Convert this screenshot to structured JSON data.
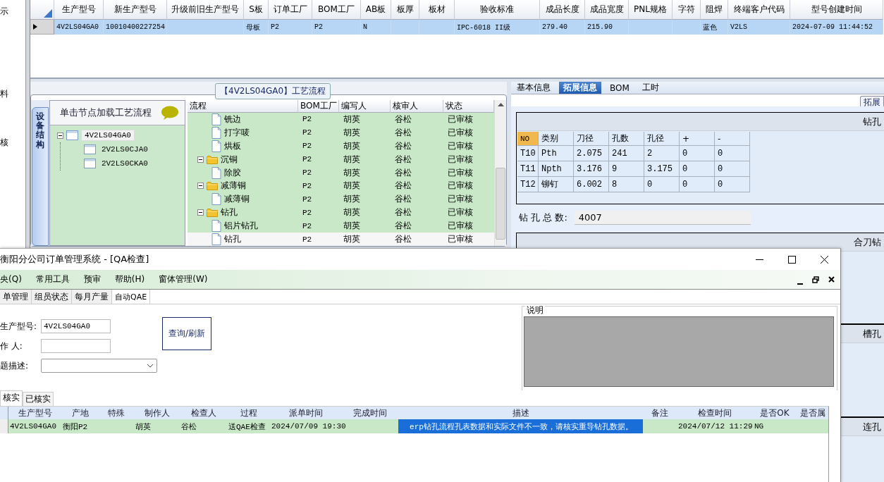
{
  "left_strip": [
    {
      "label": "示"
    },
    {
      "label": "料"
    },
    {
      "label": "核"
    }
  ],
  "model_table": {
    "columns": [
      "生产型号",
      "新生产型号",
      "升级前旧生产型号",
      "S板",
      "订单工厂",
      "BOM工厂",
      "AB板",
      "板厚",
      "板材",
      "验收标准",
      "成品长度",
      "成品宽度",
      "PNL规格",
      "字符",
      "阻焊",
      "终端客户代码",
      "型号创建时间"
    ],
    "rows": [
      {
        "selected": true,
        "cells": [
          "4V2LS04GA0",
          "10010400227254",
          null,
          "母板",
          "P2",
          "P2",
          "N",
          null,
          null,
          "IPC-6018 II级",
          "279.40",
          "215.90",
          null,
          null,
          "蓝色",
          "V2LS",
          "2024-07-09 11:44:52"
        ]
      }
    ]
  },
  "process_panel": {
    "title": "【4V2LS04GA0】工艺流程",
    "side_tab": "设备结构",
    "tree_header": "单击节点加载工艺流程",
    "tree": [
      {
        "label": "4V2LS04GA0",
        "selected": true,
        "expanded": true,
        "children": [
          {
            "label": "2V2LS0CJA0",
            "selected": false
          },
          {
            "label": "2V2LS0CKA0",
            "selected": false
          }
        ]
      }
    ],
    "flow_grid": {
      "tree_column": "流程",
      "columns": [
        "BOM工厂",
        "编写人",
        "核审人",
        "状态"
      ],
      "rows": [
        {
          "kind": "file",
          "label": "铣边",
          "cells": [
            "P2",
            "胡英",
            "谷松",
            "已审核"
          ],
          "selected": false
        },
        {
          "kind": "file",
          "label": "打字唛",
          "cells": [
            "P2",
            "胡英",
            "谷松",
            "已审核"
          ],
          "selected": false
        },
        {
          "kind": "file",
          "label": "烘板",
          "cells": [
            "P2",
            "胡英",
            "谷松",
            "已审核"
          ],
          "selected": false
        },
        {
          "kind": "folder",
          "label": "沉铜",
          "cells": [
            "P2",
            "胡英",
            "谷松",
            "已审核"
          ],
          "selected": false,
          "expanded": true,
          "children": [
            {
              "kind": "file",
              "label": "除胶",
              "cells": [
                "P2",
                "胡英",
                "谷松",
                "已审核"
              ],
              "selected": false
            }
          ]
        },
        {
          "kind": "folder",
          "label": "减薄铜",
          "cells": [
            "P2",
            "胡英",
            "谷松",
            "已审核"
          ],
          "selected": false,
          "expanded": true,
          "children": [
            {
              "kind": "file",
              "label": "减薄铜",
              "cells": [
                "P2",
                "胡英",
                "谷松",
                "已审核"
              ],
              "selected": false
            }
          ]
        },
        {
          "kind": "folder",
          "label": "钻孔",
          "cells": [
            "P2",
            "胡英",
            "谷松",
            "已审核"
          ],
          "selected": false,
          "expanded": true,
          "children": [
            {
              "kind": "file",
              "label": "铝片钻孔",
              "cells": [
                "P2",
                "胡英",
                "谷松",
                "已审核"
              ],
              "selected": false
            },
            {
              "kind": "file",
              "label": "钻孔",
              "cells": [
                "P2",
                "胡英",
                "谷松",
                "已审核"
              ],
              "selected": true
            }
          ]
        }
      ]
    }
  },
  "info_panel": {
    "tabs": [
      {
        "label": "基本信息",
        "selected": false
      },
      {
        "label": "拓展信息",
        "selected": true
      },
      {
        "label": "BOM",
        "selected": false
      },
      {
        "label": "工时",
        "selected": false
      }
    ],
    "sub_tab": "拓展",
    "drill_group": {
      "title": "钻孔",
      "columns": [
        "NO",
        "类别",
        "刀径",
        "孔数",
        "孔径",
        "+",
        "-"
      ],
      "rows": [
        [
          "T10",
          "Pth",
          "2.075",
          "241",
          "2",
          "0",
          "0"
        ],
        [
          "T11",
          "Npth",
          "3.176",
          "9",
          "3.175",
          "0",
          "0"
        ],
        [
          "T12",
          "铆钉",
          "6.002",
          "8",
          "0",
          "0",
          "0"
        ]
      ],
      "total_label": "钻 孔 总 数:",
      "total_value": "4007"
    },
    "more_groups": [
      "合刀钻",
      "槽孔",
      "连孔"
    ]
  },
  "qa_window": {
    "title": "衡阳分公司订单管理系统 - [QA检查]",
    "menu": [
      "央(Q)",
      "常用工具",
      "预审",
      "帮助(H)",
      "窗体管理(W)"
    ],
    "tabs": [
      {
        "label": "单管理",
        "selected": false
      },
      {
        "label": "组员状态",
        "selected": false
      },
      {
        "label": "每月产量",
        "selected": false
      },
      {
        "label": "自动QAE",
        "selected": true
      }
    ],
    "form": {
      "fields": [
        {
          "kind": "text",
          "label": "生产型号:",
          "value": "4V2LS04GA0"
        },
        {
          "kind": "text",
          "label": "作 人:"
        },
        {
          "kind": "dropdown",
          "label": "题描述:"
        }
      ],
      "button": "查询/刷新"
    },
    "note_group": {
      "title": "说明"
    },
    "result_tabs": [
      {
        "label": "核实",
        "selected": true
      },
      {
        "label": "已核实",
        "selected": false
      }
    ],
    "grid": {
      "columns": [
        "生产型号",
        "产地",
        "特殊",
        "制作人",
        "检查人",
        "过程",
        "派单时间",
        "完成时间",
        "描述",
        "备注",
        "检查时间",
        "是否OK",
        "是否属"
      ],
      "rows": [
        {
          "cells": [
            {
              "text": "4V2LS04GA0",
              "selected": false
            },
            {
              "text": "衡阳P2",
              "selected": false
            },
            {
              "selected": false
            },
            {
              "text": "胡英",
              "selected": false
            },
            {
              "text": "谷松",
              "selected": false
            },
            {
              "text": "送QAE检查",
              "selected": false
            },
            {
              "text": "2024/07/09 19:30",
              "selected": false
            },
            {
              "selected": false
            },
            {
              "text": "erp钻孔流程孔表数据和实际文件不一致，请核实重导钻孔数据。",
              "selected": true
            },
            {
              "selected": false
            },
            {
              "text": "2024/07/12 11:29",
              "selected": false
            },
            {
              "text": "NG",
              "selected": false
            },
            {
              "selected": false
            }
          ]
        }
      ]
    }
  }
}
